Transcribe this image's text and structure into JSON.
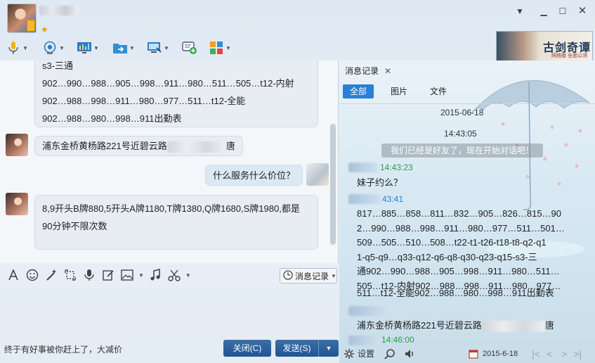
{
  "window": {
    "title_blurred": true,
    "badge_icon": "gold-star-icon",
    "controls": [
      "chevron-down-icon",
      "minimize-icon",
      "maximize-icon",
      "close-icon"
    ]
  },
  "toolbar": {
    "icons": [
      "microphone-icon",
      "webcam-icon",
      "screen-share-icon",
      "send-file-icon",
      "remote-desktop-icon",
      "add-message-icon",
      "apps-grid-icon"
    ]
  },
  "banner": {
    "title": "古剑奇谭",
    "subtitle": "网络版 全面公测"
  },
  "chat": {
    "messages": [
      {
        "side": "left",
        "lines": [
          "s3-三通",
          "902…990…988…905…998…911…980…511…505…t12-内射",
          "902…988…998…911…980…977…511…t12-全能",
          "902…988…980…998…911出勤表"
        ]
      },
      {
        "side": "left",
        "text_before": "浦东金桥黄杨路221号近碧云路",
        "text_after": "唐"
      },
      {
        "side": "right",
        "text": "什么服务什么价位？"
      },
      {
        "side": "left",
        "lines": [
          "8,9开头B牌880,5开头A牌1180,T牌1380,Q牌1680,S牌1980,都是",
          "90分钟不限次数"
        ]
      }
    ]
  },
  "input_toolbar": {
    "icons": [
      "font-icon",
      "emoji-icon",
      "magic-icon",
      "screenshot-icon",
      "voice-icon",
      "edit-icon",
      "image-icon",
      "music-icon",
      "scissors-icon"
    ],
    "history_button": "消息记录"
  },
  "footer": {
    "tip": "终于有好事被你赶上了，大减价",
    "close_label": "关闭(C)",
    "send_label": "发送(S)"
  },
  "history": {
    "tab_label": "消息记录",
    "filters": [
      "全部",
      "图片",
      "文件"
    ],
    "date": "2015-06-18",
    "time1": "14:43:05",
    "system": "我们已经是好友了，现在开始对话吧！",
    "time2": "14:43:23",
    "msg1": "妹子约么？",
    "time3": "43:41",
    "body_lines": [
      "817…885…858…811…832…905…826…815…90",
      "2…990…988…998…911…980…977…511…501…",
      "509…505…510…508…t22-t1-t26-t18-t8-q2-q1",
      "1-q5-q9…q33-q12-q6-q8-q30-q23-q15-s3-三",
      "通902…990…988…905…998…911…980…511…",
      "505…t12-内射902…988…998…911…980…977…",
      "511…t12-全能902…988…980…998…911出勤表"
    ],
    "msg3_before": "浦东金桥黄杨路221号近碧云路",
    "msg3_after": "唐",
    "time4": "14:46:00",
    "settings": "设置",
    "date_bottom": "2015-6-18"
  }
}
